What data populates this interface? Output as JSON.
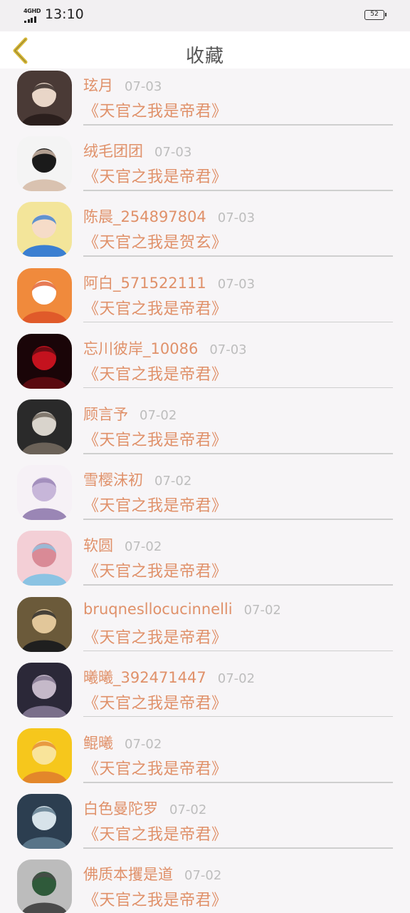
{
  "status_bar": {
    "network": "4GHD",
    "time": "13:10",
    "battery": "52"
  },
  "header": {
    "title": "收藏"
  },
  "items": [
    {
      "user": "玹月",
      "date": "07-03",
      "book": "《天官之我是帝君》",
      "avatar_colors": [
        "#4a3a36",
        "#e9d6c8",
        "#2b1f1d"
      ]
    },
    {
      "user": "绒毛团团",
      "date": "07-03",
      "book": "《天官之我是帝君》",
      "avatar_colors": [
        "#f4f4f4",
        "#1a1a1a",
        "#d9c2b0"
      ]
    },
    {
      "user": "陈晨_254897804",
      "date": "07-03",
      "book": "《天官之我是贺玄》",
      "avatar_colors": [
        "#f3e59a",
        "#f6dcc8",
        "#3b7fd1"
      ]
    },
    {
      "user": "阿白_571522111",
      "date": "07-03",
      "book": "《天官之我是帝君》",
      "avatar_colors": [
        "#f08a3c",
        "#ffffff",
        "#e05a2a"
      ]
    },
    {
      "user": "忘川彼岸_10086",
      "date": "07-03",
      "book": "《天官之我是帝君》",
      "avatar_colors": [
        "#1a0508",
        "#c4121e",
        "#5a0a10"
      ]
    },
    {
      "user": "顾言予",
      "date": "07-02",
      "book": "《天官之我是帝君》",
      "avatar_colors": [
        "#2a2a2a",
        "#d9d4cc",
        "#6b6258"
      ]
    },
    {
      "user": "雪樱沫初",
      "date": "07-02",
      "book": "《天官之我是帝君》",
      "avatar_colors": [
        "#f6f1f6",
        "#c7b6d9",
        "#9a86b5"
      ]
    },
    {
      "user": "软圆",
      "date": "07-02",
      "book": "《天官之我是帝君》",
      "avatar_colors": [
        "#f3cfd6",
        "#d98a96",
        "#8bc3e3"
      ]
    },
    {
      "user": "bruqnesllocucinnelli",
      "date": "07-02",
      "book": "《天官之我是帝君》",
      "avatar_colors": [
        "#6b5a3a",
        "#e2c79a",
        "#1f1f1f"
      ]
    },
    {
      "user": "曦曦_392471447",
      "date": "07-02",
      "book": "《天官之我是帝君》",
      "avatar_colors": [
        "#2b2838",
        "#c5b9c9",
        "#7a6f8a"
      ]
    },
    {
      "user": "鲲曦",
      "date": "07-02",
      "book": "《天官之我是帝君》",
      "avatar_colors": [
        "#f6c71c",
        "#f9e49a",
        "#e3872a"
      ]
    },
    {
      "user": "白色曼陀罗",
      "date": "07-02",
      "book": "《天官之我是帝君》",
      "avatar_colors": [
        "#2c3e50",
        "#d7e3ea",
        "#587488"
      ]
    },
    {
      "user": "佛质本攫是道",
      "date": "07-02",
      "book": "《天官之我是帝君》",
      "avatar_colors": [
        "#bcbcbc",
        "#2f5a3a",
        "#4a4a4a"
      ]
    }
  ]
}
